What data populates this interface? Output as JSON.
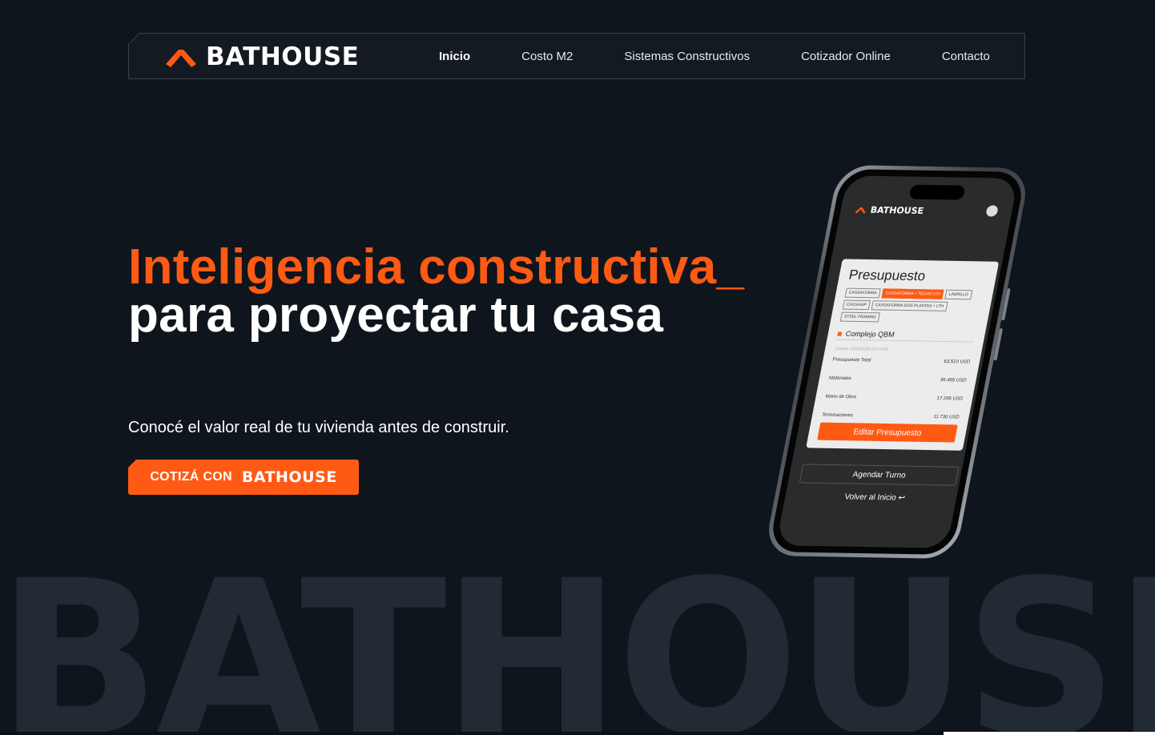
{
  "brand": {
    "name": "BATHOUSE",
    "accent": "#ff5a14",
    "background": "#0f151d"
  },
  "nav": {
    "items": [
      {
        "label": "Inicio",
        "active": true
      },
      {
        "label": "Costo M2",
        "active": false
      },
      {
        "label": "Sistemas Constructivos",
        "active": false
      },
      {
        "label": "Cotizador Online",
        "active": false
      },
      {
        "label": "Contacto",
        "active": false
      }
    ]
  },
  "hero": {
    "title_accent": "Inteligencia constructiva_",
    "title_main": "para proyectar tu casa",
    "subtitle": "Conocé el valor real de tu vivienda antes de construir.",
    "cta_prefix": "COTIZÁ CON",
    "cta_brand": "BATHOUSE"
  },
  "watermark": "BATHOUSE",
  "phone": {
    "app_name": "BATHOUSE",
    "card_title": "Presupuesto",
    "chips": [
      {
        "label": "CASSAFORMA",
        "on": false
      },
      {
        "label": "CASSAFORMA + TECHO LTH",
        "on": true
      },
      {
        "label": "LADRILLO",
        "on": false
      },
      {
        "label": "CASSASIP",
        "on": false
      },
      {
        "label": "CASSAFORMA DOS PLANTAS + LTH",
        "on": false
      },
      {
        "label": "STEEL FRAMING",
        "on": false
      }
    ],
    "project": "Complejo QBM",
    "created": "Creado: 15/03/2026 03:24 PM",
    "rows": [
      {
        "label": "Presupuesto Total",
        "value": "63.510 USD"
      },
      {
        "label": "Materiales",
        "value": "36.485 USD"
      },
      {
        "label": "Mano de Obra",
        "value": "17.295 USD"
      },
      {
        "label": "Terminaciones",
        "value": "11.730 USD"
      }
    ],
    "edit_button": "Editar Presupuesto",
    "turno_button": "Agendar Turno",
    "back_link": "Volver al Inicio ↩"
  }
}
